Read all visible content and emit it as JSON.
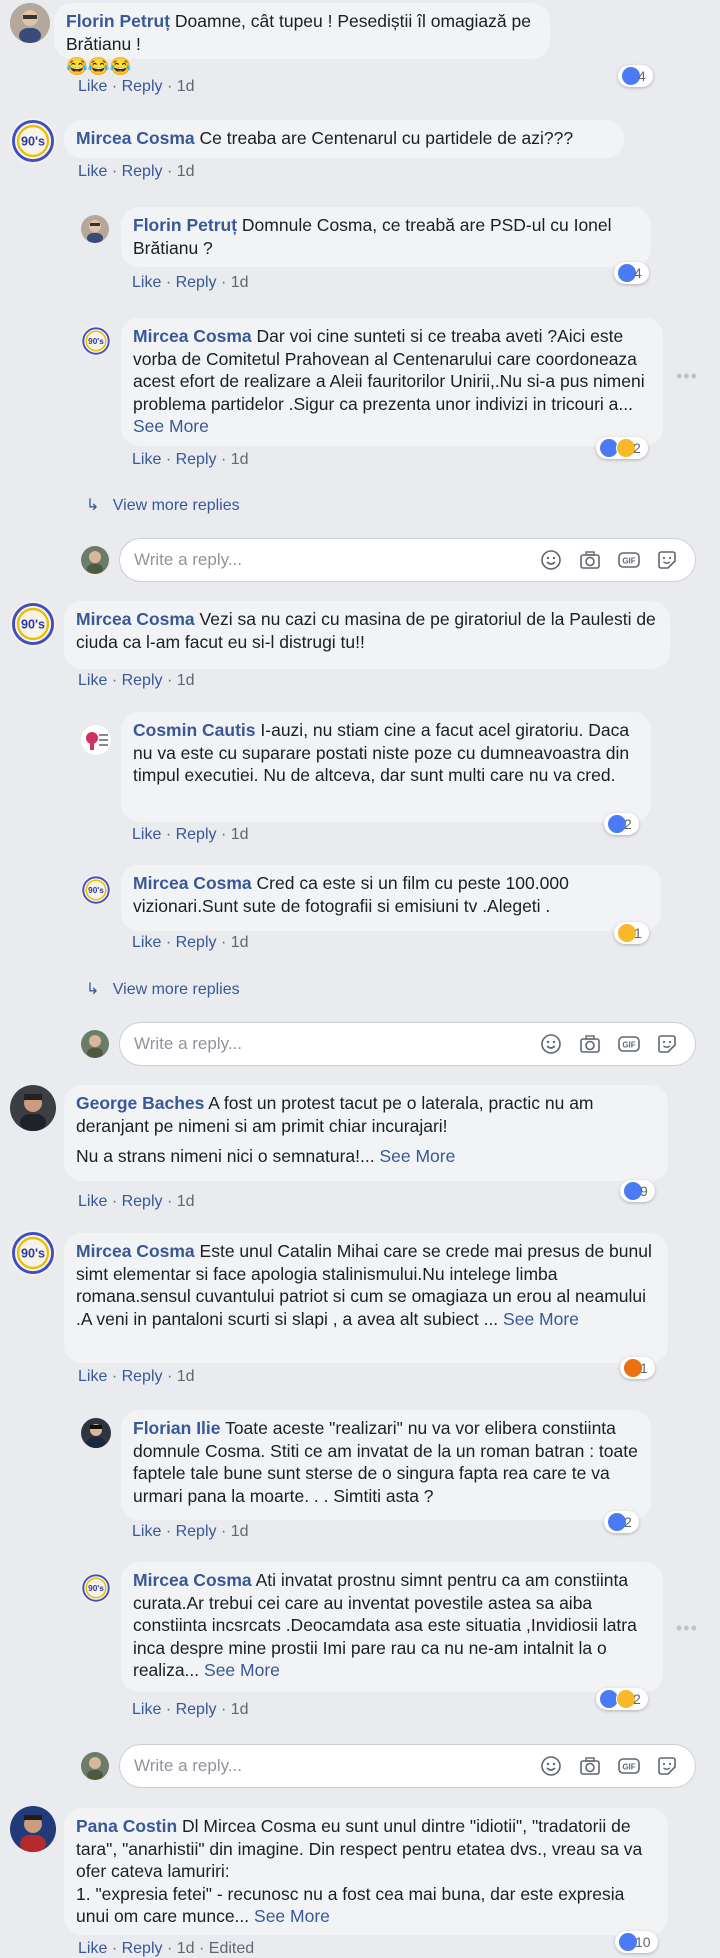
{
  "actions": {
    "like": "Like",
    "reply": "Reply",
    "sep": "·",
    "edited": "Edited"
  },
  "reply_placeholder": "Write a reply...",
  "view_more_replies": "View more replies",
  "see_more": "See More",
  "comments": [
    {
      "author": "Florin Petruț",
      "text": "Doamne, cât tupeu ! Pesediștii îl omagiază pe Brătianu !",
      "emoji": "😂😂😂",
      "time": "1d",
      "reactions": "4",
      "react_types": [
        "like"
      ]
    },
    {
      "author": "Mircea Cosma",
      "text": "Ce treaba are Centenarul cu partidele de azi???",
      "time": "1d"
    },
    {
      "author": "Florin Petruț",
      "text": "Domnule Cosma, ce treabă are PSD-ul cu Ionel Brătianu ?",
      "time": "1d",
      "reactions": "4",
      "react_types": [
        "like"
      ]
    },
    {
      "author": "Mircea Cosma",
      "text": "Dar voi cine sunteti si ce treaba aveti ?Aici este vorba de Comitetul Prahovean al Centenarului care coordoneaza acest efort de realizare a Aleii fauritorilor Unirii,.Nu si-a pus nimeni problema partidelor .Sigur ca prezenta unor indivizi in tricouri a...",
      "time": "1d",
      "reactions": "2",
      "react_types": [
        "like",
        "haha"
      ]
    },
    {
      "author": "Mircea Cosma",
      "text": "Vezi sa nu cazi cu masina de pe giratoriul de la Paulesti de ciuda ca l-am facut eu si-l distrugi tu!!",
      "time": "1d"
    },
    {
      "author": "Cosmin Cautis",
      "text": "I-auzi, nu stiam cine a facut acel giratoriu. Daca nu va este cu suparare postati niste poze cu dumneavoastra din timpul executiei. Nu de altceva, dar sunt multi care nu va cred.",
      "time": "1d",
      "reactions": "2",
      "react_types": [
        "like"
      ]
    },
    {
      "author": "Mircea Cosma",
      "text": "Cred ca este si un film cu peste 100.000 vizionari.Sunt sute de fotografii si emisiuni tv .Alegeti .",
      "time": "1d",
      "reactions": "1",
      "react_types": [
        "haha"
      ]
    },
    {
      "author": "George Baches",
      "text": "A fost un protest tacut pe o laterala, practic nu am deranjant pe nimeni si am primit chiar incurajari!",
      "text2": "Nu a strans nimeni nici o semnatura!...",
      "time": "1d",
      "reactions": "9",
      "react_types": [
        "like"
      ]
    },
    {
      "author": "Mircea Cosma",
      "text": "Este unul Catalin Mihai care se crede mai presus de bunul simt elementar si face apologia stalinismului.Nu intelege limba romana.sensul cuvantului patriot si cum se omagiaza un erou al neamului .A veni in pantaloni scurti si slapi , a avea alt subiect ...",
      "time": "1d",
      "reactions": "1",
      "react_types": [
        "angry"
      ]
    },
    {
      "author": "Florian Ilie",
      "text": "Toate aceste \"realizari\" nu va vor elibera constiinta domnule Cosma. Stiti ce am invatat de la un roman batran : toate faptele tale bune sunt sterse de o singura fapta rea care te va urmari pana la moarte. . . Simtiti asta ?",
      "time": "1d",
      "reactions": "2",
      "react_types": [
        "like"
      ]
    },
    {
      "author": "Mircea Cosma",
      "text": "Ati invatat prostnu simnt pentru ca am constiinta curata.Ar trebui cei care au inventat povestile astea sa aiba constiinta incsrcats .Deocamdata asa este situatia ,Invidiosii latra inca despre mine prostii Imi pare rau ca nu ne-am intalnit la o realiza...",
      "time": "1d",
      "reactions": "2",
      "react_types": [
        "like",
        "haha"
      ]
    },
    {
      "author": "Pana Costin",
      "text": "Dl Mircea Cosma eu sunt unul dintre \"idiotii\", \"tradatorii de tara\", \"anarhistii\" din imagine. Din respect pentru etatea dvs., vreau sa va ofer cateva lamuriri:",
      "text2": "1. \"expresia fetei\" - recunosc nu a fost cea mai buna, dar este expresia unui om care munce...",
      "time": "1d",
      "reactions": "10",
      "react_types": [
        "like"
      ]
    }
  ],
  "colors": {
    "link": "#385898",
    "bubble": "#f2f3f5",
    "bg": "#e9ebee",
    "meta": "#606770"
  }
}
